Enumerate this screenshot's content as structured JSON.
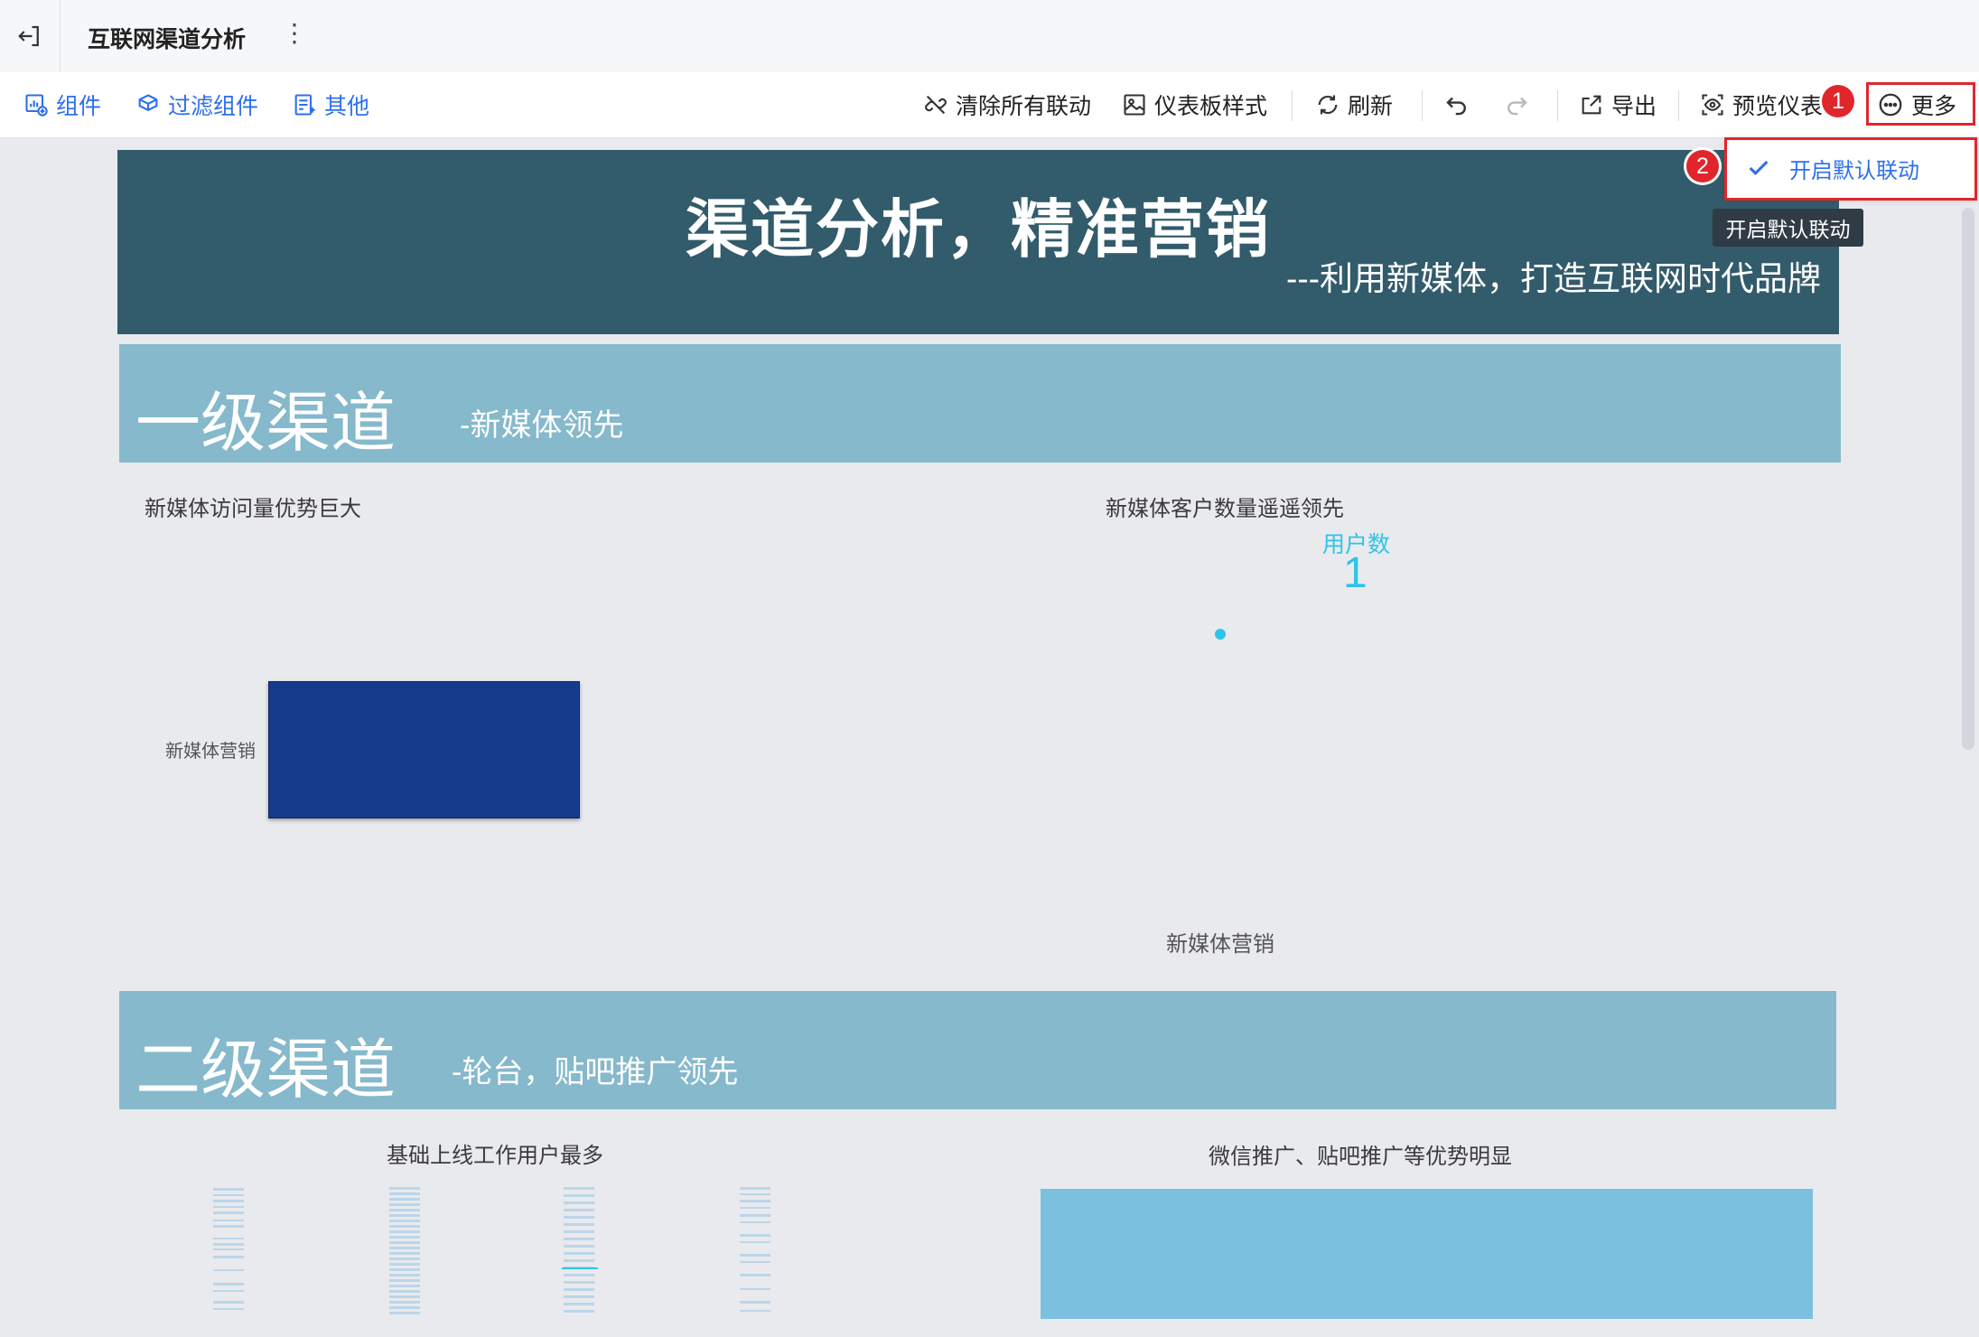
{
  "titlebar": {
    "title": "互联网渠道分析",
    "menu_glyph": "⋮"
  },
  "toolbar": {
    "components": "组件",
    "filter_components": "过滤组件",
    "others": "其他",
    "clear_linkage": "清除所有联动",
    "dashboard_style": "仪表板样式",
    "refresh": "刷新",
    "export": "导出",
    "preview": "预览仪表",
    "more": "更多"
  },
  "dropdown": {
    "item": "开启默认联动"
  },
  "tooltip": "开启默认联动",
  "markers": {
    "one": "1",
    "two": "2"
  },
  "hero": {
    "title": "渠道分析，精准营销",
    "subtitle": "---利用新媒体，打造互联网时代品牌"
  },
  "level1": {
    "title": "一级渠道",
    "subtitle": "-新媒体领先",
    "chart_left": {
      "title": "新媒体访问量优势巨大",
      "category": "新媒体营销"
    },
    "chart_right": {
      "title": "新媒体客户数量遥遥领先",
      "measure": "用户数",
      "value": "1",
      "category": "新媒体营销"
    }
  },
  "level2": {
    "title": "二级渠道",
    "subtitle": "-轮台，贴吧推广领先",
    "chart_left": {
      "title": "基础上线工作用户最多"
    },
    "chart_right": {
      "title": "微信推广、贴吧推广等优势明显"
    }
  },
  "colors": {
    "hero_bg": "#325b6b",
    "band_bg": "#85b9cb",
    "bar_dark": "#163a8c",
    "bar_light": "#7cc0df",
    "accent": "#2d6ff0",
    "highlight": "#e0262b",
    "kpi": "#2ec4e8"
  },
  "icons": [
    "exit-icon",
    "components-icon",
    "filter-icon",
    "others-icon",
    "unlink-icon",
    "style-icon",
    "refresh-icon",
    "undo-icon",
    "redo-icon",
    "export-icon",
    "preview-icon",
    "more-icon",
    "check-icon"
  ]
}
